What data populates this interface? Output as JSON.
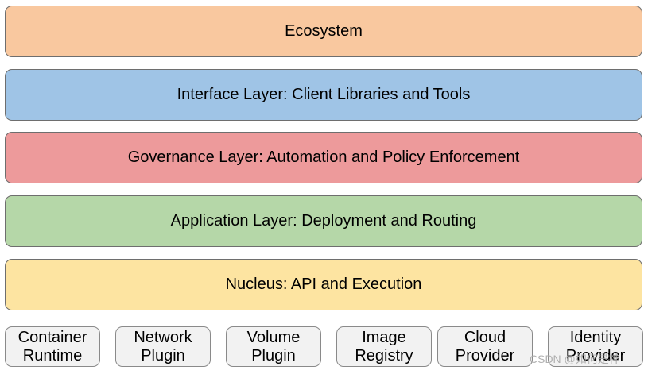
{
  "layers": [
    {
      "label": "Ecosystem",
      "color": "#f9c89f"
    },
    {
      "label": "Interface Layer: Client Libraries and Tools",
      "color": "#9fc4e6"
    },
    {
      "label": "Governance Layer: Automation and Policy Enforcement",
      "color": "#ed9a9b"
    },
    {
      "label": "Application Layer: Deployment and Routing",
      "color": "#b5d7a8"
    },
    {
      "label": "Nucleus: API and Execution",
      "color": "#fde4a1"
    }
  ],
  "plugins": [
    {
      "line1": "Container",
      "line2": "Runtime"
    },
    {
      "line1": "Network",
      "line2": "Plugin"
    },
    {
      "line1": "Volume",
      "line2": "Plugin"
    },
    {
      "line1": "Image",
      "line2": "Registry"
    },
    {
      "line1": "Cloud",
      "line2": "Provider"
    },
    {
      "line1": "Identity",
      "line2": "Provider"
    }
  ],
  "watermark": "CSDN @如何是神"
}
